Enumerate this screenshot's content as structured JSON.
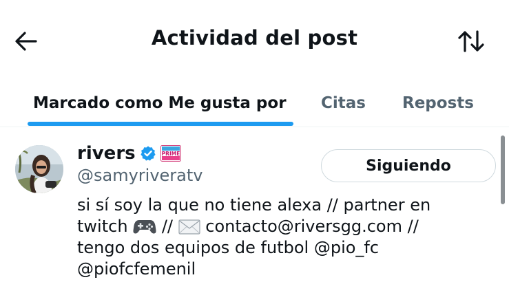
{
  "header": {
    "title": "Actividad del post",
    "back_icon": "arrow-left-icon",
    "sort_icon": "sort-arrows-icon"
  },
  "tabs": [
    {
      "label": "Marcado como Me gusta por",
      "active": true
    },
    {
      "label": "Citas",
      "active": false
    },
    {
      "label": "Reposts",
      "active": false
    }
  ],
  "user": {
    "display_name": "rivers",
    "handle": "@samyriveratv",
    "badge_label": "PRIME",
    "follow_label": "Siguiendo",
    "bio_line1": "si sí soy la que no tiene alexa // partner en",
    "bio_line2a": "twitch",
    "bio_line2b": "//",
    "bio_line2c": "contacto@riversgg.com //",
    "bio_line3": "tengo dos equipos de futbol @pio_fc",
    "bio_line4": "@piofcfemenil"
  },
  "colors": {
    "accent": "#1d9bf0",
    "text_primary": "#0f1419",
    "text_secondary": "#536471",
    "border": "#cfd9de"
  }
}
